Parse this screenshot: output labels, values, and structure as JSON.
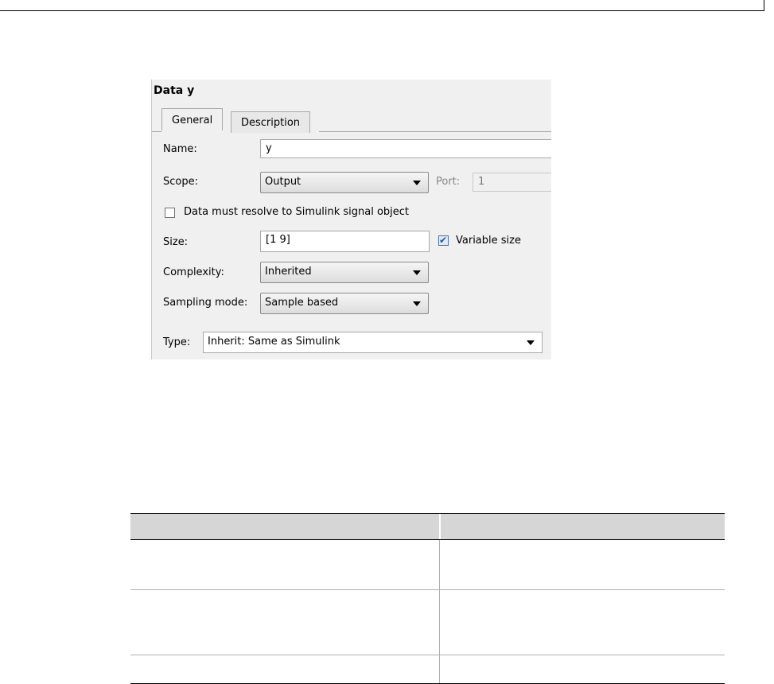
{
  "dialog": {
    "title": "Data y",
    "tabs": [
      {
        "label": "General",
        "active": true
      },
      {
        "label": "Description",
        "active": false
      }
    ],
    "name": {
      "label": "Name:",
      "value": "y"
    },
    "scope": {
      "label": "Scope:",
      "value": "Output"
    },
    "port": {
      "label": "Port:",
      "value": "1"
    },
    "resolve": {
      "label": "Data must resolve to Simulink signal object",
      "checked": false
    },
    "size": {
      "label": "Size:",
      "value": "[1 9]"
    },
    "variable_size": {
      "label": "Variable size",
      "checked": true
    },
    "complexity": {
      "label": "Complexity:",
      "value": "Inherited"
    },
    "sampling_mode": {
      "label": "Sampling mode:",
      "value": "Sample based"
    },
    "type": {
      "label": "Type:",
      "value": "Inherit: Same as Simulink"
    }
  },
  "table": {
    "headers": [
      "",
      ""
    ],
    "rows": [
      [
        "",
        ""
      ],
      [
        "",
        ""
      ],
      [
        "",
        ""
      ]
    ]
  }
}
